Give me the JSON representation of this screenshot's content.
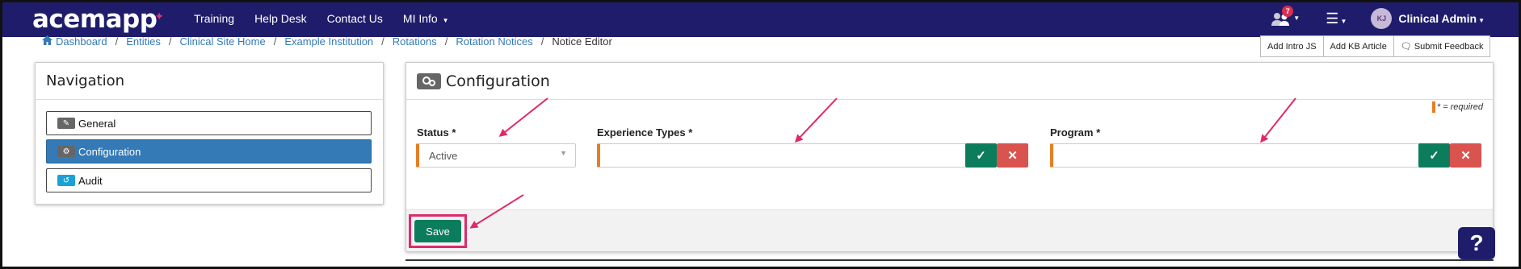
{
  "app": {
    "logo": "acemapp"
  },
  "topnav": {
    "links": [
      "Training",
      "Help Desk",
      "Contact Us",
      "MI Info"
    ],
    "notification_count": "7",
    "avatar_initials": "KJ",
    "user_name": "Clinical Admin"
  },
  "breadcrumb": [
    "Dashboard",
    "Entities",
    "Clinical Site Home",
    "Example Institution",
    "Rotations",
    "Rotation Notices",
    "Notice Editor"
  ],
  "tools": [
    "Add Intro JS",
    "Add KB Article",
    "Submit Feedback"
  ],
  "navigation": {
    "title": "Navigation",
    "items": [
      {
        "label": "General",
        "icon": "pencil-icon"
      },
      {
        "label": "Configuration",
        "icon": "gears-icon"
      },
      {
        "label": "Audit",
        "icon": "history-icon"
      }
    ]
  },
  "config": {
    "title": "Configuration",
    "required_note": "* = required",
    "status_label": "Status *",
    "status_value": "Active",
    "experience_label": "Experience Types *",
    "program_label": "Program *",
    "save_label": "Save"
  },
  "help": "?",
  "colors": {
    "navy": "#1f1d6b",
    "accent": "#e0296a",
    "required": "#e67e22",
    "primary": "#337ab7",
    "success": "#0c7d5c",
    "danger": "#d9534f"
  }
}
